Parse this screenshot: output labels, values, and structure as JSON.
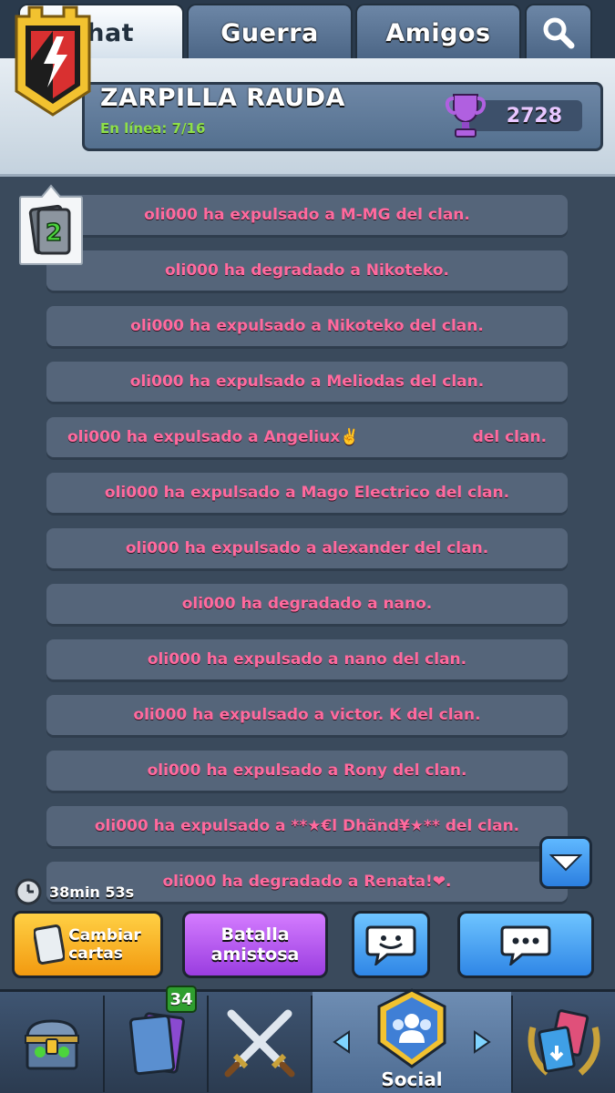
{
  "tabs": {
    "chat": "Chat",
    "guerra": "Guerra",
    "amigos": "Amigos"
  },
  "clan": {
    "name": "ZARPILLA RAUDA",
    "online": "En línea: 7/16",
    "trophies": "2728",
    "badge_colors": {
      "gold": "#f2c230",
      "red": "#d93030",
      "shield": "#1d1d1d"
    }
  },
  "level_badge": "2",
  "messages": [
    "oli000 ha expulsado a M-MG del clan.",
    "oli000 ha degradado a Nikoteko.",
    "oli000 ha expulsado a Nikoteko del clan.",
    "oli000 ha expulsado a Meliodas del clan.",
    "oli000 ha expulsado a Angeliux✌️                     del clan.",
    "oli000 ha expulsado a Mago Electrico del clan.",
    "oli000 ha expulsado a alexander del clan.",
    "oli000 ha degradado a nano.",
    "oli000 ha expulsado a nano del clan.",
    "oli000 ha expulsado a victor. K del clan.",
    "oli000 ha expulsado a Rony del clan.",
    "oli000 ha expulsado a **★€l Dhänd¥★** del clan.",
    "oli000 ha degradado a Renata!❤."
  ],
  "timer": "38min 53s",
  "actions": {
    "cambiar": "Cambiar\ncartas",
    "batalla": "Batalla\namistosa"
  },
  "nav": {
    "cards_count": "34",
    "social": "Social"
  },
  "icons": [
    "search-icon",
    "trophy-icon",
    "clan-badge-icon",
    "card-icon",
    "clock-icon",
    "chevron-down-icon",
    "emote-icon",
    "chat-bubble-icon",
    "chest-icon",
    "cards-icon",
    "crossed-swords-icon",
    "social-icon",
    "tournament-icon",
    "arrow-left-icon",
    "arrow-right-icon"
  ]
}
